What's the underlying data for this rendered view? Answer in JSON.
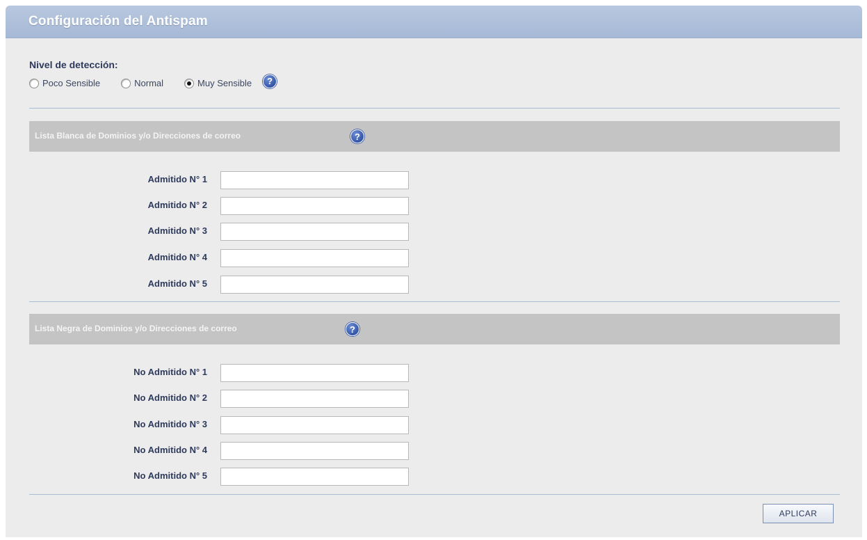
{
  "panel": {
    "title": "Configuración del Antispam"
  },
  "detection": {
    "label": "Nivel de detección:",
    "options": [
      {
        "label": "Poco Sensible",
        "selected": false
      },
      {
        "label": "Normal",
        "selected": false
      },
      {
        "label": "Muy Sensible",
        "selected": true
      }
    ],
    "help_icon": "question-mark-icon"
  },
  "whitelist": {
    "title": "Lista Blanca de Dominios y/o Direcciones de correo",
    "help_icon": "question-mark-icon",
    "fields": [
      {
        "label": "Admitido N° 1",
        "value": ""
      },
      {
        "label": "Admitido N° 2",
        "value": ""
      },
      {
        "label": "Admitido N° 3",
        "value": ""
      },
      {
        "label": "Admitido N° 4",
        "value": ""
      },
      {
        "label": "Admitido N° 5",
        "value": ""
      }
    ]
  },
  "blacklist": {
    "title": "Lista Negra de Dominios y/o Direcciones de correo",
    "help_icon": "question-mark-icon",
    "fields": [
      {
        "label": "No Admitido N° 1",
        "value": ""
      },
      {
        "label": "No Admitido N° 2",
        "value": ""
      },
      {
        "label": "No Admitido N° 3",
        "value": ""
      },
      {
        "label": "No Admitido N° 4",
        "value": ""
      },
      {
        "label": "No Admitido N° 5",
        "value": ""
      }
    ]
  },
  "actions": {
    "apply_label": "APLICAR"
  },
  "colors": {
    "header": "#a5b8d5",
    "panel_bg": "#ececec",
    "section_bar": "#c4c4c4",
    "label_text": "#2e3a5c",
    "help_icon": "#1d3f96"
  }
}
